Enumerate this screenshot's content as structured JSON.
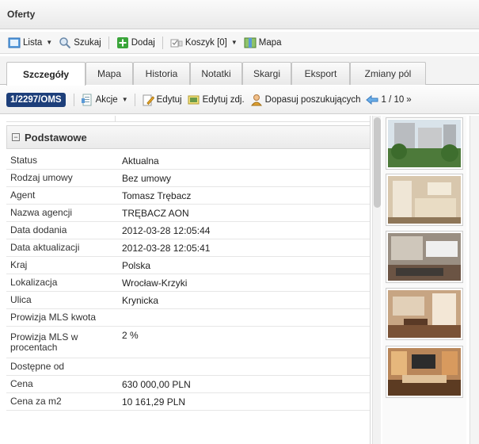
{
  "window": {
    "title": "Oferty"
  },
  "toolbar": {
    "lista": "Lista",
    "szukaj": "Szukaj",
    "dodaj": "Dodaj",
    "koszyk": "Koszyk [0]",
    "mapa": "Mapa"
  },
  "tabs": [
    {
      "label": "Szczegóły",
      "active": true
    },
    {
      "label": "Mapa"
    },
    {
      "label": "Historia"
    },
    {
      "label": "Notatki"
    },
    {
      "label": "Skargi"
    },
    {
      "label": "Eksport"
    },
    {
      "label": "Zmiany pól"
    }
  ],
  "actions": {
    "offer_id": "1/2297/OMS",
    "akcje": "Akcje",
    "edytuj": "Edytuj",
    "edytuj_zdj": "Edytuj zdj.",
    "dopasuj": "Dopasuj poszukujących",
    "pager": "1 / 10",
    "pager_next": "»"
  },
  "section": {
    "title": "Podstawowe"
  },
  "details": [
    {
      "label": "Status",
      "value": "Aktualna"
    },
    {
      "label": "Rodzaj umowy",
      "value": "Bez umowy"
    },
    {
      "label": "Agent",
      "value": "Tomasz Trębacz"
    },
    {
      "label": "Nazwa agencji",
      "value": "TRĘBACZ AON"
    },
    {
      "label": "Data dodania",
      "value": "2012-03-28 12:05:44"
    },
    {
      "label": "Data aktualizacji",
      "value": "2012-03-28 12:05:41"
    },
    {
      "label": "Kraj",
      "value": "Polska"
    },
    {
      "label": "Lokalizacja",
      "value": "Wrocław-Krzyki"
    },
    {
      "label": "Ulica",
      "value": "Krynicka"
    },
    {
      "label": "Prowizja MLS kwota",
      "value": ""
    },
    {
      "label": "Prowizja MLS w procentach",
      "value": "2 %"
    },
    {
      "label": "Dostępne od",
      "value": ""
    },
    {
      "label": "Cena",
      "value": "630 000,00 PLN"
    },
    {
      "label": "Cena za m2",
      "value": "10 161,29 PLN"
    }
  ],
  "colors": {
    "id_badge": "#1d3f7a",
    "add_green": "#3aa53a"
  }
}
